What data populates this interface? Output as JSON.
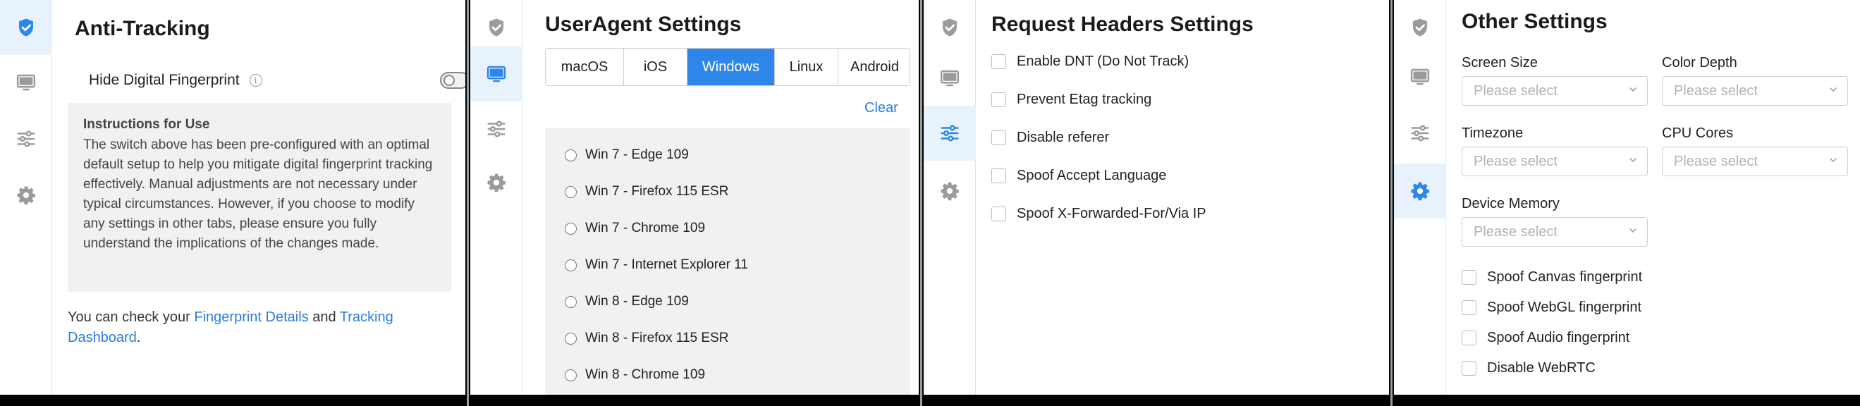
{
  "anti_tracking": {
    "title": "Anti-Tracking",
    "hide_fp_label": "Hide Digital Fingerprint",
    "info_glyph": "i",
    "toggle_on": false,
    "instructions_title": "Instructions for Use",
    "instructions_body": "The switch above has been pre-configured with an optimal default setup to help you mitigate digital fingerprint tracking effectively. Manual adjustments are not necessary under typical circumstances. However, if you choose to modify any settings in other tabs, please ensure you fully understand the implications of the changes made.",
    "check_prefix": "You can check your ",
    "fp_details_link": "Fingerprint Details",
    "and": " and ",
    "tracking_link": "Tracking Dashboard",
    "period": "."
  },
  "useragent": {
    "title": "UserAgent Settings",
    "tabs": [
      "macOS",
      "iOS",
      "Windows",
      "Linux",
      "Android"
    ],
    "active_tab": "Windows",
    "clear_label": "Clear",
    "items": [
      "Win 7 - Edge 109",
      "Win 7 - Firefox 115 ESR",
      "Win 7 - Chrome 109",
      "Win 7 - Internet Explorer 11",
      "Win 8 - Edge 109",
      "Win 8 - Firefox 115 ESR",
      "Win 8 - Chrome 109"
    ]
  },
  "request_headers": {
    "title": "Request Headers Settings",
    "items": [
      "Enable DNT (Do Not Track)",
      "Prevent Etag tracking",
      "Disable referer",
      "Spoof Accept Language",
      "Spoof X-Forwarded-For/Via IP"
    ]
  },
  "other": {
    "title": "Other Settings",
    "screen_size_label": "Screen Size",
    "color_depth_label": "Color Depth",
    "timezone_label": "Timezone",
    "cpu_cores_label": "CPU Cores",
    "device_memory_label": "Device Memory",
    "placeholder": "Please select",
    "spoof_items": [
      "Spoof Canvas fingerprint",
      "Spoof WebGL fingerprint",
      "Spoof Audio fingerprint",
      "Disable WebRTC"
    ]
  },
  "nav_icons": [
    "shield-check-icon",
    "monitor-icon",
    "sliders-icon",
    "gear-icon"
  ],
  "colors": {
    "accent": "#2f86ea",
    "active_bg": "#e8f2fd",
    "muted_icon": "#9b9b9b"
  }
}
